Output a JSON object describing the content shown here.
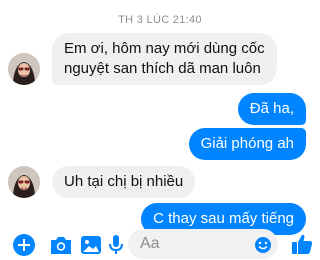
{
  "header": {
    "timestamp": "TH 3 LÚC 21:40"
  },
  "messages": [
    {
      "side": "incoming",
      "text_lines": [
        "Em ơi, hôm nay mới dùng cốc",
        "nguyệt san thích dã man luôn"
      ]
    },
    {
      "side": "outgoing",
      "text": "Đã ha,"
    },
    {
      "side": "outgoing",
      "text": "Giải phóng ah"
    },
    {
      "side": "incoming",
      "text": "Uh tại chị bị nhiều"
    },
    {
      "side": "outgoing",
      "text": "C thay sau mấy tiếng"
    }
  ],
  "composer": {
    "placeholder": "Aa",
    "icons": [
      "plus-icon",
      "camera-icon",
      "image-icon",
      "microphone-icon",
      "emoji-icon",
      "thumbs-up-icon"
    ]
  },
  "colors": {
    "accent": "#0084ff",
    "incoming_bubble": "#f0f0f0",
    "timestamp": "#8e8e93"
  }
}
